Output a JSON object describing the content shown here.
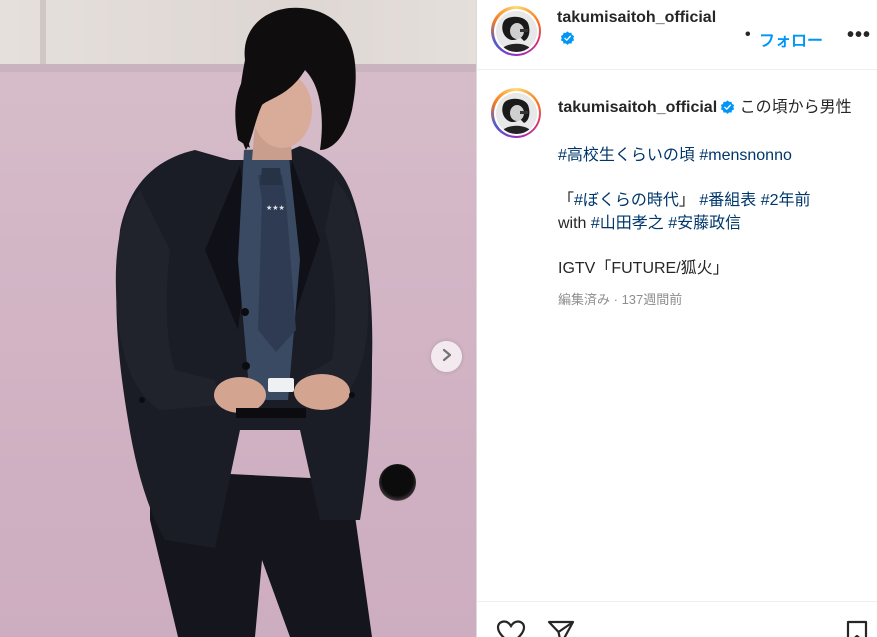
{
  "post": {
    "username": "takumisaitoh_official",
    "separator": "•",
    "follow_label": "フォロー",
    "more_label": "•••"
  },
  "caption": {
    "text_start": "この頃から男性",
    "tags_line1": [
      "#高校生くらいの頃",
      "#mensnonno"
    ],
    "line2_open": "「",
    "line2_tag1": "#ぼくらの時代",
    "line2_close": "」",
    "line2_tags": [
      "#番組表",
      "#2年前"
    ],
    "line3_prefix": "with",
    "line3_tags": [
      "#山田孝之",
      "#安藤政信"
    ],
    "line4": "IGTV「FUTURE/狐火」",
    "edited": "編集済み",
    "meta_sep": " · ",
    "time_ago": "137週間前"
  },
  "icons": {
    "verified": "verified-badge-icon",
    "carousel_next": "chevron-right-icon",
    "like": "heart-icon",
    "share": "send-icon",
    "save": "bookmark-icon"
  },
  "colors": {
    "link": "#00376b",
    "follow": "#0095f6",
    "verified": "#0095f6",
    "text": "#262626",
    "muted": "#8e8e8e"
  }
}
